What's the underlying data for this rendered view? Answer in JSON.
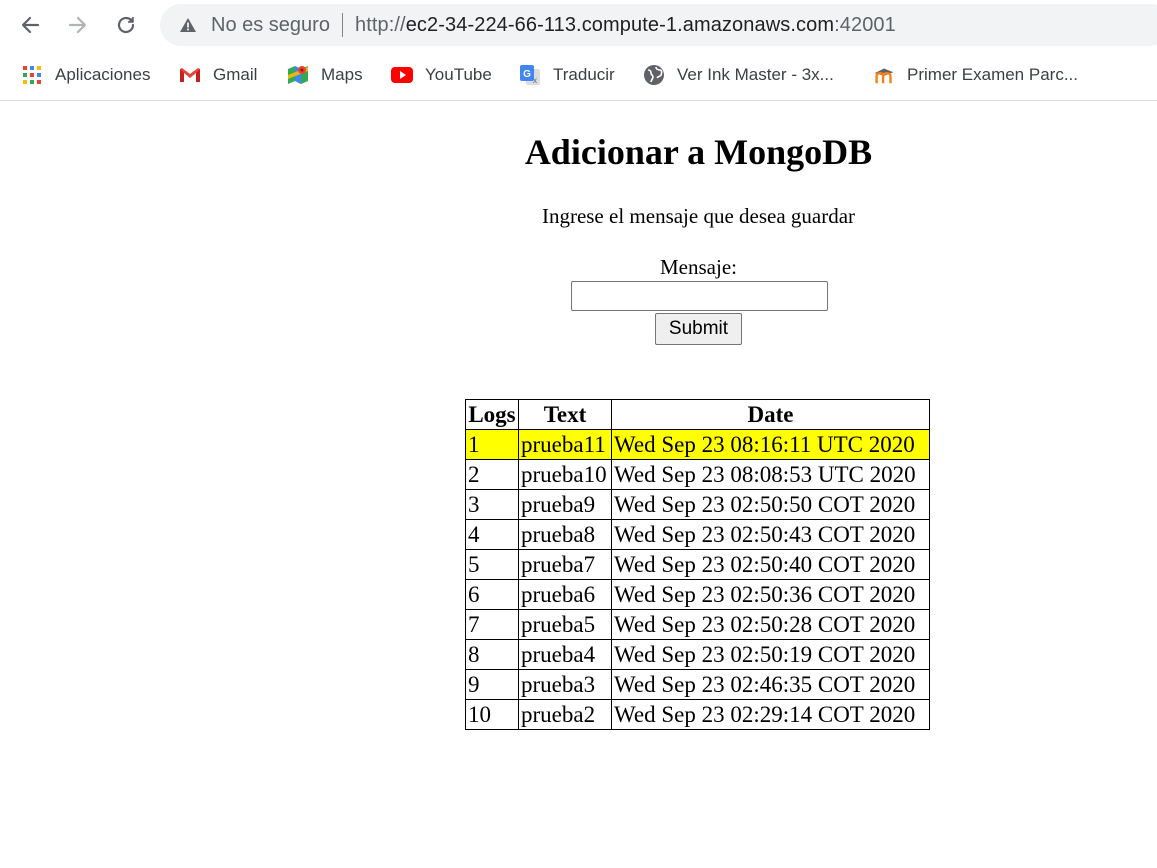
{
  "browser": {
    "security_label": "No es seguro",
    "url_scheme": "http://",
    "url_host": "ec2-34-224-66-113.compute-1.amazonaws.com",
    "url_port": ":42001"
  },
  "bookmarks": [
    {
      "label": "Aplicaciones",
      "icon": "apps-grid-icon"
    },
    {
      "label": "Gmail",
      "icon": "gmail-icon"
    },
    {
      "label": "Maps",
      "icon": "maps-icon"
    },
    {
      "label": "YouTube",
      "icon": "youtube-icon"
    },
    {
      "label": "Traducir",
      "icon": "translate-icon"
    },
    {
      "label": "Ver Ink Master - 3x...",
      "icon": "globe-icon"
    },
    {
      "label": "Primer Examen Parc...",
      "icon": "moodle-icon"
    }
  ],
  "page": {
    "title": "Adicionar a MongoDB",
    "instructions": "Ingrese el mensaje que desea guardar",
    "message_label": "Mensaje:",
    "message_value": "",
    "submit_label": "Submit"
  },
  "table": {
    "headers": [
      "Logs",
      "Text",
      "Date"
    ],
    "rows": [
      [
        "1",
        "prueba11",
        "Wed Sep 23 08:16:11 UTC 2020"
      ],
      [
        "2",
        "prueba10",
        "Wed Sep 23 08:08:53 UTC 2020"
      ],
      [
        "3",
        "prueba9",
        "Wed Sep 23 02:50:50 COT 2020"
      ],
      [
        "4",
        "prueba8",
        "Wed Sep 23 02:50:43 COT 2020"
      ],
      [
        "5",
        "prueba7",
        "Wed Sep 23 02:50:40 COT 2020"
      ],
      [
        "6",
        "prueba6",
        "Wed Sep 23 02:50:36 COT 2020"
      ],
      [
        "7",
        "prueba5",
        "Wed Sep 23 02:50:28 COT 2020"
      ],
      [
        "8",
        "prueba4",
        "Wed Sep 23 02:50:19 COT 2020"
      ],
      [
        "9",
        "prueba3",
        "Wed Sep 23 02:46:35 COT 2020"
      ],
      [
        "10",
        "prueba2",
        "Wed Sep 23 02:29:14 COT 2020"
      ]
    ],
    "highlight_color": "#ffff00"
  }
}
